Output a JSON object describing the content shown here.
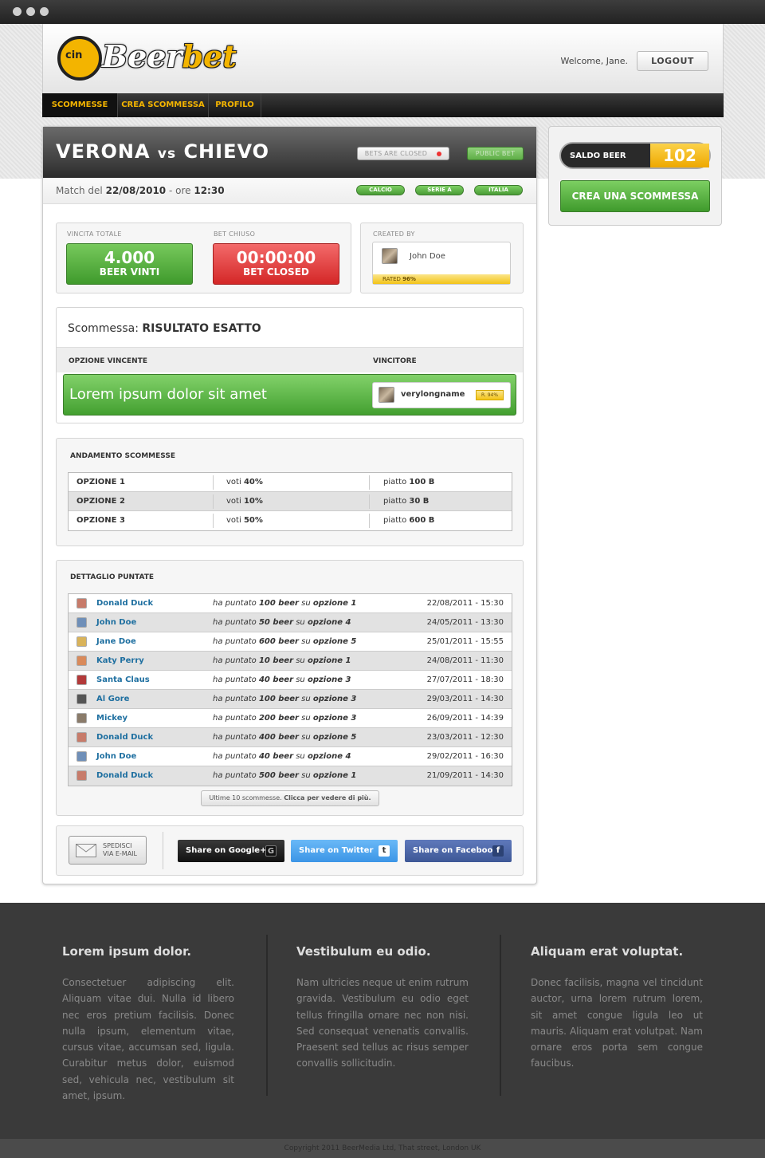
{
  "header": {
    "logo_text_1": "Beer",
    "logo_text_2": "bet",
    "logo_icon_text": "cin",
    "welcome": "Welcome, Jane.",
    "logout": "LOGOUT"
  },
  "nav": {
    "items": [
      {
        "label": "SCOMMESSE"
      },
      {
        "label": "CREA SCOMMESSA"
      },
      {
        "label": "PROFILO"
      }
    ]
  },
  "match": {
    "team1": "VERONA",
    "vs": "vs",
    "team2": "CHIEVO",
    "closed_pill": "BETS ARE CLOSED",
    "public_pill": "PUBLIC BET",
    "date_prefix": "Match del",
    "date": "22/08/2010",
    "time_prefix": "- ore",
    "time": "12:30",
    "tags": [
      "CALCIO",
      "SERIE A",
      "ITALIA"
    ]
  },
  "stats": {
    "vincita_label": "VINCITA TOTALE",
    "vincita_value": "4.000",
    "vincita_unit": "BEER VINTI",
    "bet_label": "BET CHIUSO",
    "bet_value": "00:00:00",
    "bet_unit": "BET CLOSED",
    "created_label": "CREATED BY",
    "creator_name": "John Doe",
    "creator_rated_label": "RATED",
    "creator_rated_value": "96%"
  },
  "bet": {
    "title_prefix": "Scommessa:",
    "title": "RISULTATO ESATTO",
    "col_option": "OPZIONE VINCENTE",
    "col_winner": "VINCITORE",
    "winning_option": "Lorem ipsum dolor sit amet",
    "winner_name": "verylongname",
    "winner_rate": "R. 94%"
  },
  "andamento": {
    "title": "ANDAMENTO SCOMMESSE",
    "rows": [
      {
        "option": "OPZIONE 1",
        "voti_label": "voti",
        "voti": "40%",
        "piatto_label": "piatto",
        "piatto": "100 B"
      },
      {
        "option": "OPZIONE 2",
        "voti_label": "voti",
        "voti": "10%",
        "piatto_label": "piatto",
        "piatto": "30 B"
      },
      {
        "option": "OPZIONE 3",
        "voti_label": "voti",
        "voti": "50%",
        "piatto_label": "piatto",
        "piatto": "600 B"
      }
    ]
  },
  "dettaglio": {
    "title": "DETTAGLIO PUNTATE",
    "prefix": "ha puntato",
    "mid": "su",
    "rows": [
      {
        "name": "Donald Duck",
        "amount": "100 beer",
        "option": "opzione 1",
        "date": "22/08/2011 - 15:30"
      },
      {
        "name": "John Doe",
        "amount": "50 beer",
        "option": "opzione 4",
        "date": "24/05/2011 - 13:30"
      },
      {
        "name": "Jane Doe",
        "amount": "600 beer",
        "option": "opzione 5",
        "date": "25/01/2011 - 15:55"
      },
      {
        "name": "Katy Perry",
        "amount": "10 beer",
        "option": "opzione 1",
        "date": "24/08/2011 - 11:30"
      },
      {
        "name": "Santa Claus",
        "amount": "40 beer",
        "option": "opzione 3",
        "date": "27/07/2011 - 18:30"
      },
      {
        "name": "Al Gore",
        "amount": "100 beer",
        "option": "opzione 3",
        "date": "29/03/2011 - 14:30"
      },
      {
        "name": "Mickey",
        "amount": "200 beer",
        "option": "opzione 3",
        "date": "26/09/2011 - 14:39"
      },
      {
        "name": "Donald Duck",
        "amount": "400 beer",
        "option": "opzione 5",
        "date": "23/03/2011 - 12:30"
      },
      {
        "name": "John Doe",
        "amount": "40 beer",
        "option": "opzione 4",
        "date": "29/02/2011 - 16:30"
      },
      {
        "name": "Donald Duck",
        "amount": "500 beer",
        "option": "opzione 1",
        "date": "21/09/2011 - 14:30"
      }
    ],
    "more_text": "Ultime 10 scommesse.",
    "more_link": "Clicca per vedere di più."
  },
  "share": {
    "mail_line1": "SPEDISCI",
    "mail_line2": "VIA E-MAIL",
    "google": "Share on Google+",
    "twitter": "Share on Twitter",
    "facebook": "Share on Facebook",
    "google_icon": "G",
    "twitter_icon": "t",
    "facebook_icon": "f",
    "colors": {
      "google": "#1b1b1b",
      "twitter": "#4aa3f0",
      "facebook": "#4a63a6"
    }
  },
  "sidebar": {
    "saldo_label": "SALDO BEER",
    "saldo_value": "102",
    "crea_button": "CREA UNA SCOMMESSA"
  },
  "footer": {
    "columns": [
      {
        "title": "Lorem ipsum dolor.",
        "text": "Consectetuer adipiscing elit. Aliquam vitae dui. Nulla id libero nec eros pretium facilisis. Donec nulla ipsum, elementum vitae, cursus vitae, accumsan sed, ligula. Curabitur metus dolor, euismod sed, vehicula nec, vestibulum sit amet, ipsum."
      },
      {
        "title": "Vestibulum eu odio.",
        "text": "Nam ultricies neque ut enim rutrum gravida. Vestibulum eu odio eget tellus fringilla ornare nec non nisi. Sed consequat venenatis convallis. Praesent sed tellus ac risus semper convallis sollicitudin."
      },
      {
        "title": "Aliquam erat voluptat.",
        "text": "Donec facilisis, magna vel tincidunt auctor, urna lorem rutrum lorem, sit amet congue ligula leo ut mauris. Aliquam erat volutpat. Nam ornare eros porta sem congue faucibus."
      }
    ],
    "copyright": "Copyright 2011 BeerMedia Ltd, That street, London UK"
  },
  "colors": {
    "accent": "#f3b400",
    "green": "#4aa236",
    "red": "#d42727",
    "link": "#1e6fa0"
  }
}
